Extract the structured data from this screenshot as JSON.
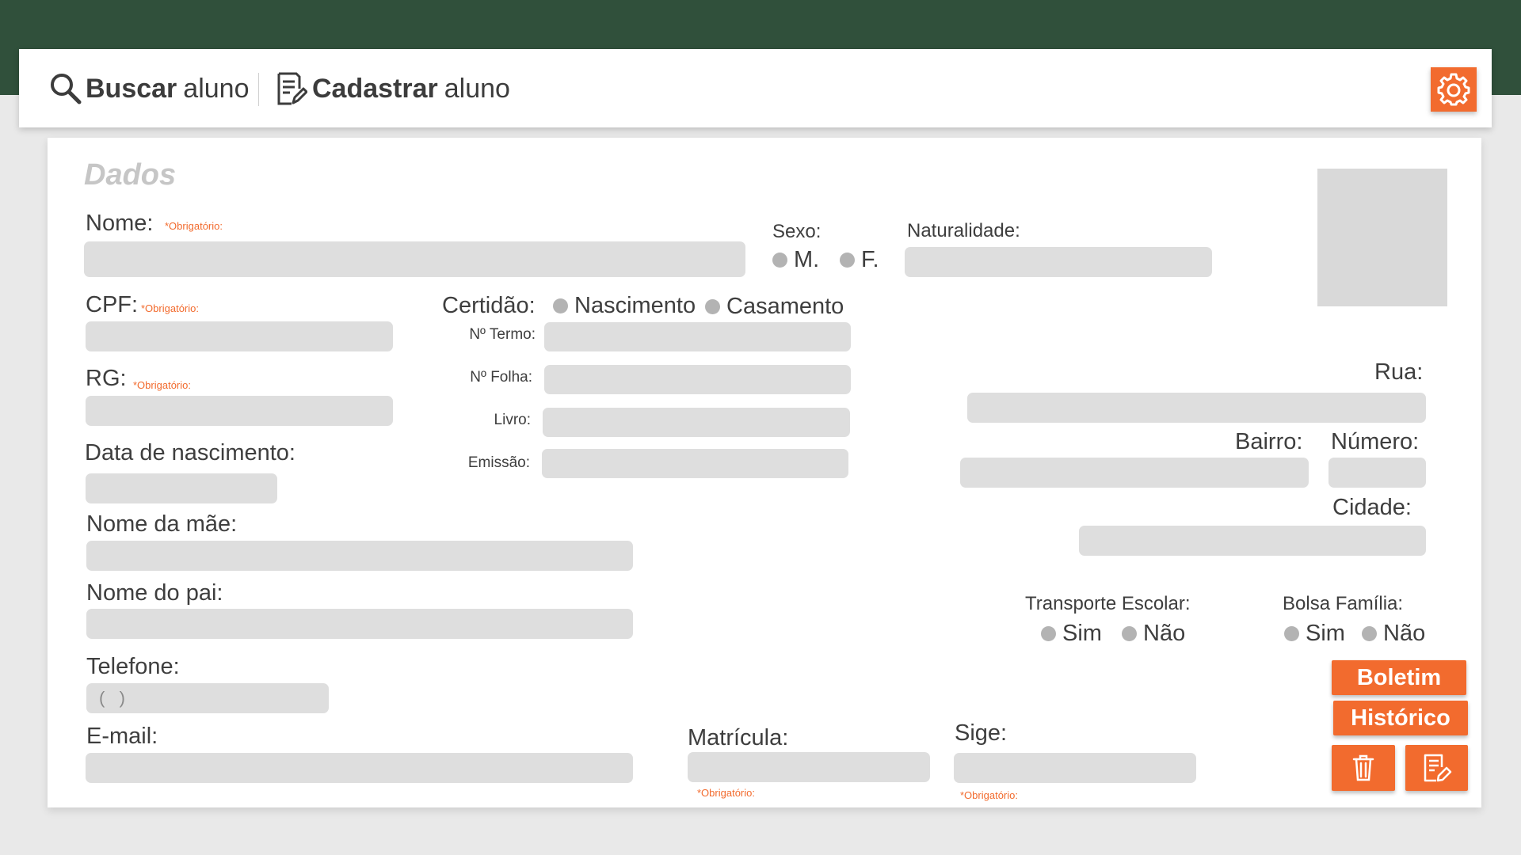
{
  "nav": {
    "search": {
      "bold": "Buscar",
      "rest": "aluno",
      "icon": "search-icon"
    },
    "register": {
      "bold": "Cadastrar",
      "rest": "aluno",
      "icon": "form-edit-icon"
    },
    "settings_icon": "gear-icon"
  },
  "form": {
    "section_title": "Dados",
    "required_text": "*Obrigatório:",
    "nome": {
      "label": "Nome:",
      "value": ""
    },
    "sexo": {
      "label": "Sexo:",
      "options": [
        "M.",
        "F."
      ]
    },
    "naturalidade": {
      "label": "Naturalidade:",
      "value": ""
    },
    "cpf": {
      "label": "CPF:",
      "value": ""
    },
    "certidao": {
      "label": "Certidão:",
      "options": [
        "Nascimento",
        "Casamento"
      ],
      "termo": "Nº Termo:",
      "folha": "Nº Folha:",
      "livro": "Livro:",
      "emissao": "Emissão:"
    },
    "rg": {
      "label": "RG:",
      "value": ""
    },
    "data_nascimento": {
      "label": "Data de nascimento:",
      "value": ""
    },
    "nome_mae": {
      "label": "Nome da mãe:",
      "value": ""
    },
    "nome_pai": {
      "label": "Nome do pai:",
      "value": ""
    },
    "telefone": {
      "label": "Telefone:",
      "value": "(   )"
    },
    "email": {
      "label": "E-mail:",
      "value": ""
    },
    "matricula": {
      "label": "Matrícula:",
      "value": ""
    },
    "sige": {
      "label": "Sige:",
      "value": ""
    },
    "rua": {
      "label": "Rua:",
      "value": ""
    },
    "bairro": {
      "label": "Bairro:",
      "value": ""
    },
    "numero": {
      "label": "Número:",
      "value": ""
    },
    "cidade": {
      "label": "Cidade:",
      "value": ""
    },
    "transporte": {
      "label": "Transporte Escolar:",
      "options": [
        "Sim",
        "Não"
      ]
    },
    "bolsa": {
      "label": "Bolsa Família:",
      "options": [
        "Sim",
        "Não"
      ]
    }
  },
  "actions": {
    "boletim": "Boletim",
    "historico": "Histórico",
    "delete_icon": "trash-icon",
    "edit_icon": "edit-document-icon"
  },
  "colors": {
    "header_band": "#30503b",
    "accent": "#f26b2e",
    "field_bg": "#dedede",
    "title_gray": "#c6c6c6"
  }
}
